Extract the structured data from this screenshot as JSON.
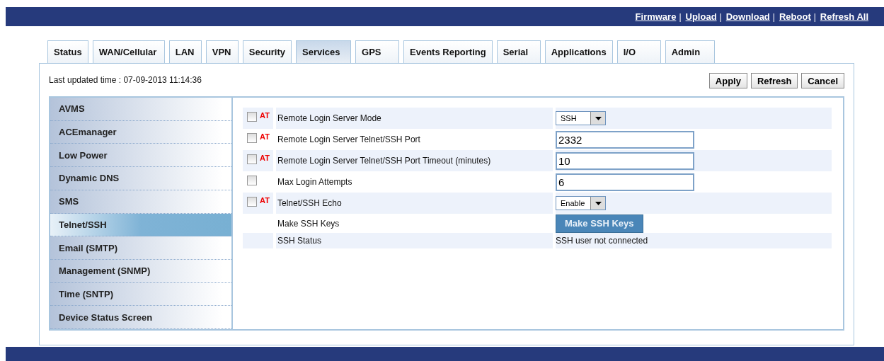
{
  "header_links": [
    {
      "kind": "link",
      "text": "Firmware"
    },
    {
      "kind": "separator",
      "text": "|"
    },
    {
      "kind": "link",
      "text": "Upload"
    },
    {
      "kind": "separator",
      "text": "|"
    },
    {
      "kind": "link",
      "text": "Download"
    },
    {
      "kind": "separator",
      "text": "|"
    },
    {
      "kind": "link",
      "text": "Reboot"
    },
    {
      "kind": "separator",
      "text": "|"
    },
    {
      "kind": "link",
      "text": "Refresh All"
    }
  ],
  "tabs": [
    {
      "label": "Status",
      "selected": false
    },
    {
      "label": "WAN/Cellular",
      "selected": false
    },
    {
      "label": "LAN",
      "selected": false
    },
    {
      "label": "VPN",
      "selected": false
    },
    {
      "label": "Security",
      "selected": false
    },
    {
      "label": "Services",
      "selected": true
    },
    {
      "label": "GPS",
      "selected": false
    },
    {
      "label": "Events Reporting",
      "selected": false
    },
    {
      "label": "Serial",
      "selected": false
    },
    {
      "label": "Applications",
      "selected": false
    },
    {
      "label": "I/O",
      "selected": false
    },
    {
      "label": "Admin",
      "selected": false
    }
  ],
  "last_updated": "Last updated time : 07-09-2013 11:14:36",
  "buttons": [
    "Apply",
    "Refresh",
    "Cancel"
  ],
  "sidebar": {
    "items": [
      {
        "label": "AVMS",
        "selected": false
      },
      {
        "label": "ACEmanager",
        "selected": false
      },
      {
        "label": "Low Power",
        "selected": false
      },
      {
        "label": "Dynamic DNS",
        "selected": false
      },
      {
        "label": "SMS",
        "selected": false
      },
      {
        "label": "Telnet/SSH",
        "selected": true
      },
      {
        "label": "Email (SMTP)",
        "selected": false
      },
      {
        "label": "Management (SNMP)",
        "selected": false
      },
      {
        "label": "Time (SNTP)",
        "selected": false
      },
      {
        "label": "Device Status Screen",
        "selected": false
      }
    ]
  },
  "settings": [
    {
      "kind": "select",
      "label": "Remote Login Server Mode",
      "checked": false,
      "at": "AT",
      "value": "SSH"
    },
    {
      "kind": "text",
      "label": "Remote Login Server Telnet/SSH Port",
      "checked": false,
      "at": "AT",
      "value": "2332"
    },
    {
      "kind": "text",
      "label": "Remote Login Server Telnet/SSH Port Timeout (minutes)",
      "checked": false,
      "at": "AT",
      "value": "10"
    },
    {
      "kind": "text",
      "label": "Max Login Attempts",
      "checked": false,
      "value": "6"
    },
    {
      "kind": "select",
      "label": "Telnet/SSH Echo",
      "checked": false,
      "at": "AT",
      "value": "Enable"
    },
    {
      "kind": "button",
      "label": "Make SSH Keys",
      "value": "Make SSH Keys"
    },
    {
      "kind": "status",
      "label": "SSH Status",
      "value": "SSH user not connected"
    }
  ]
}
